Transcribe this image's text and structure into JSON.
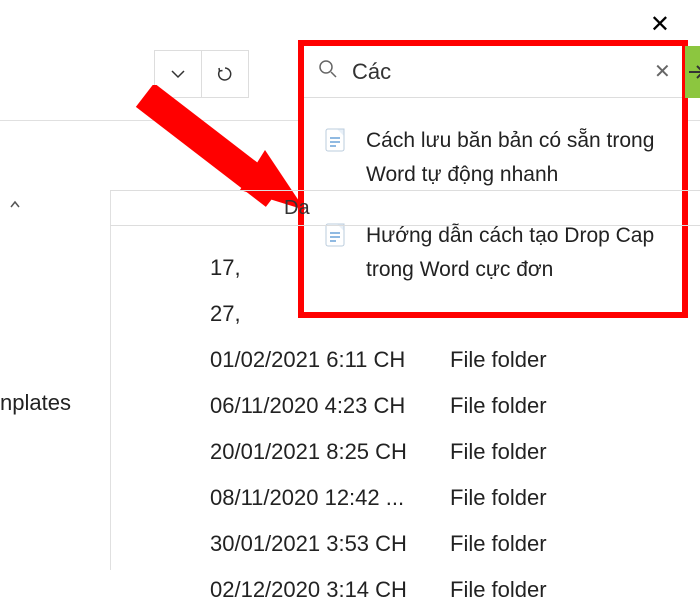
{
  "window": {
    "close_icon_name": "close-icon"
  },
  "toolbar": {
    "dropdown_icon": "chevron-down-icon",
    "refresh_icon": "refresh-icon"
  },
  "search": {
    "placeholder": "",
    "value": "Các",
    "submit_color": "#8cc63f"
  },
  "suggestions": [
    {
      "text": "Cách lưu băn bản có sẵn trong Word tự động nhanh",
      "icon": "word-doc-icon"
    },
    {
      "text": "Hướng dẫn cách tạo Drop Cap trong Word cực đơn",
      "icon": "word-doc-icon"
    }
  ],
  "sidebar": {
    "item_label": "nplates"
  },
  "columns": {
    "date_label": "Da"
  },
  "rows": [
    {
      "date": "17,",
      "type": ""
    },
    {
      "date": "27,",
      "type": ""
    },
    {
      "date": "01/02/2021 6:11 CH",
      "type": "File folder"
    },
    {
      "date": "06/11/2020 4:23 CH",
      "type": "File folder"
    },
    {
      "date": "20/01/2021 8:25 CH",
      "type": "File folder"
    },
    {
      "date": "08/11/2020 12:42 ...",
      "type": "File folder"
    },
    {
      "date": "30/01/2021 3:53 CH",
      "type": "File folder"
    },
    {
      "date": "02/12/2020 3:14 CH",
      "type": "File folder"
    }
  ]
}
